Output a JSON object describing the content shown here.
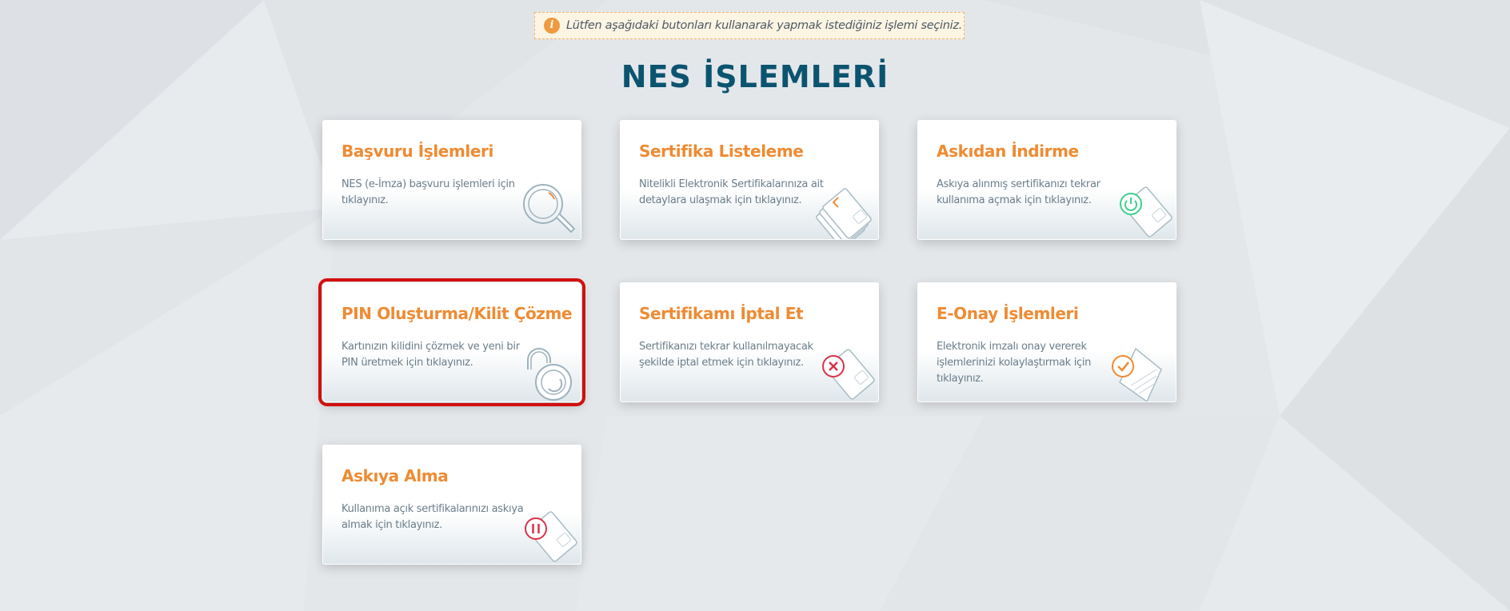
{
  "notice": {
    "icon": "info-icon",
    "text": "Lütfen aşağıdaki butonları kullanarak yapmak istediğiniz işlemi seçiniz."
  },
  "title": "NES İŞLEMLERİ",
  "colors": {
    "title": "#0b5470",
    "card_title": "#ee8b33",
    "card_text": "#6a7d8a",
    "highlight": "#d20f0f",
    "notice_bg": "#fdf5e4",
    "notice_border": "#f0b26a"
  },
  "cards": [
    {
      "title": "Başvuru İşlemleri",
      "desc": "NES (e-İmza) başvuru işlemleri için tıklayınız.",
      "icon": "magnifier-icon"
    },
    {
      "title": "Sertifika Listeleme",
      "desc": "Nitelikli Elektronik Sertifikalarınıza ait detaylara ulaşmak için tıklayınız.",
      "icon": "card-list-icon"
    },
    {
      "title": "Askıdan İndirme",
      "desc": "Askıya alınmış sertifikanızı tekrar kullanıma açmak için tıklayınız.",
      "icon": "card-power-icon"
    },
    {
      "title": "PIN Oluşturma/Kilit Çözme",
      "desc": "Kartınızın kilidini çözmek ve yeni bir PIN üretmek için tıklayınız.",
      "icon": "padlock-icon",
      "highlighted": true
    },
    {
      "title": "Sertifikamı İptal Et",
      "desc": "Sertifikanızı tekrar kullanılmayacak şekilde iptal etmek için tıklayınız.",
      "icon": "card-cancel-icon"
    },
    {
      "title": "E-Onay İşlemleri",
      "desc": "Elektronik imzalı onay vererek işlemlerinizi kolaylaştırmak için tıklayınız.",
      "icon": "document-check-icon"
    },
    {
      "title": "Askıya Alma",
      "desc": "Kullanıma açık sertifikalarınızı askıya almak için tıklayınız.",
      "icon": "card-pause-icon"
    }
  ]
}
